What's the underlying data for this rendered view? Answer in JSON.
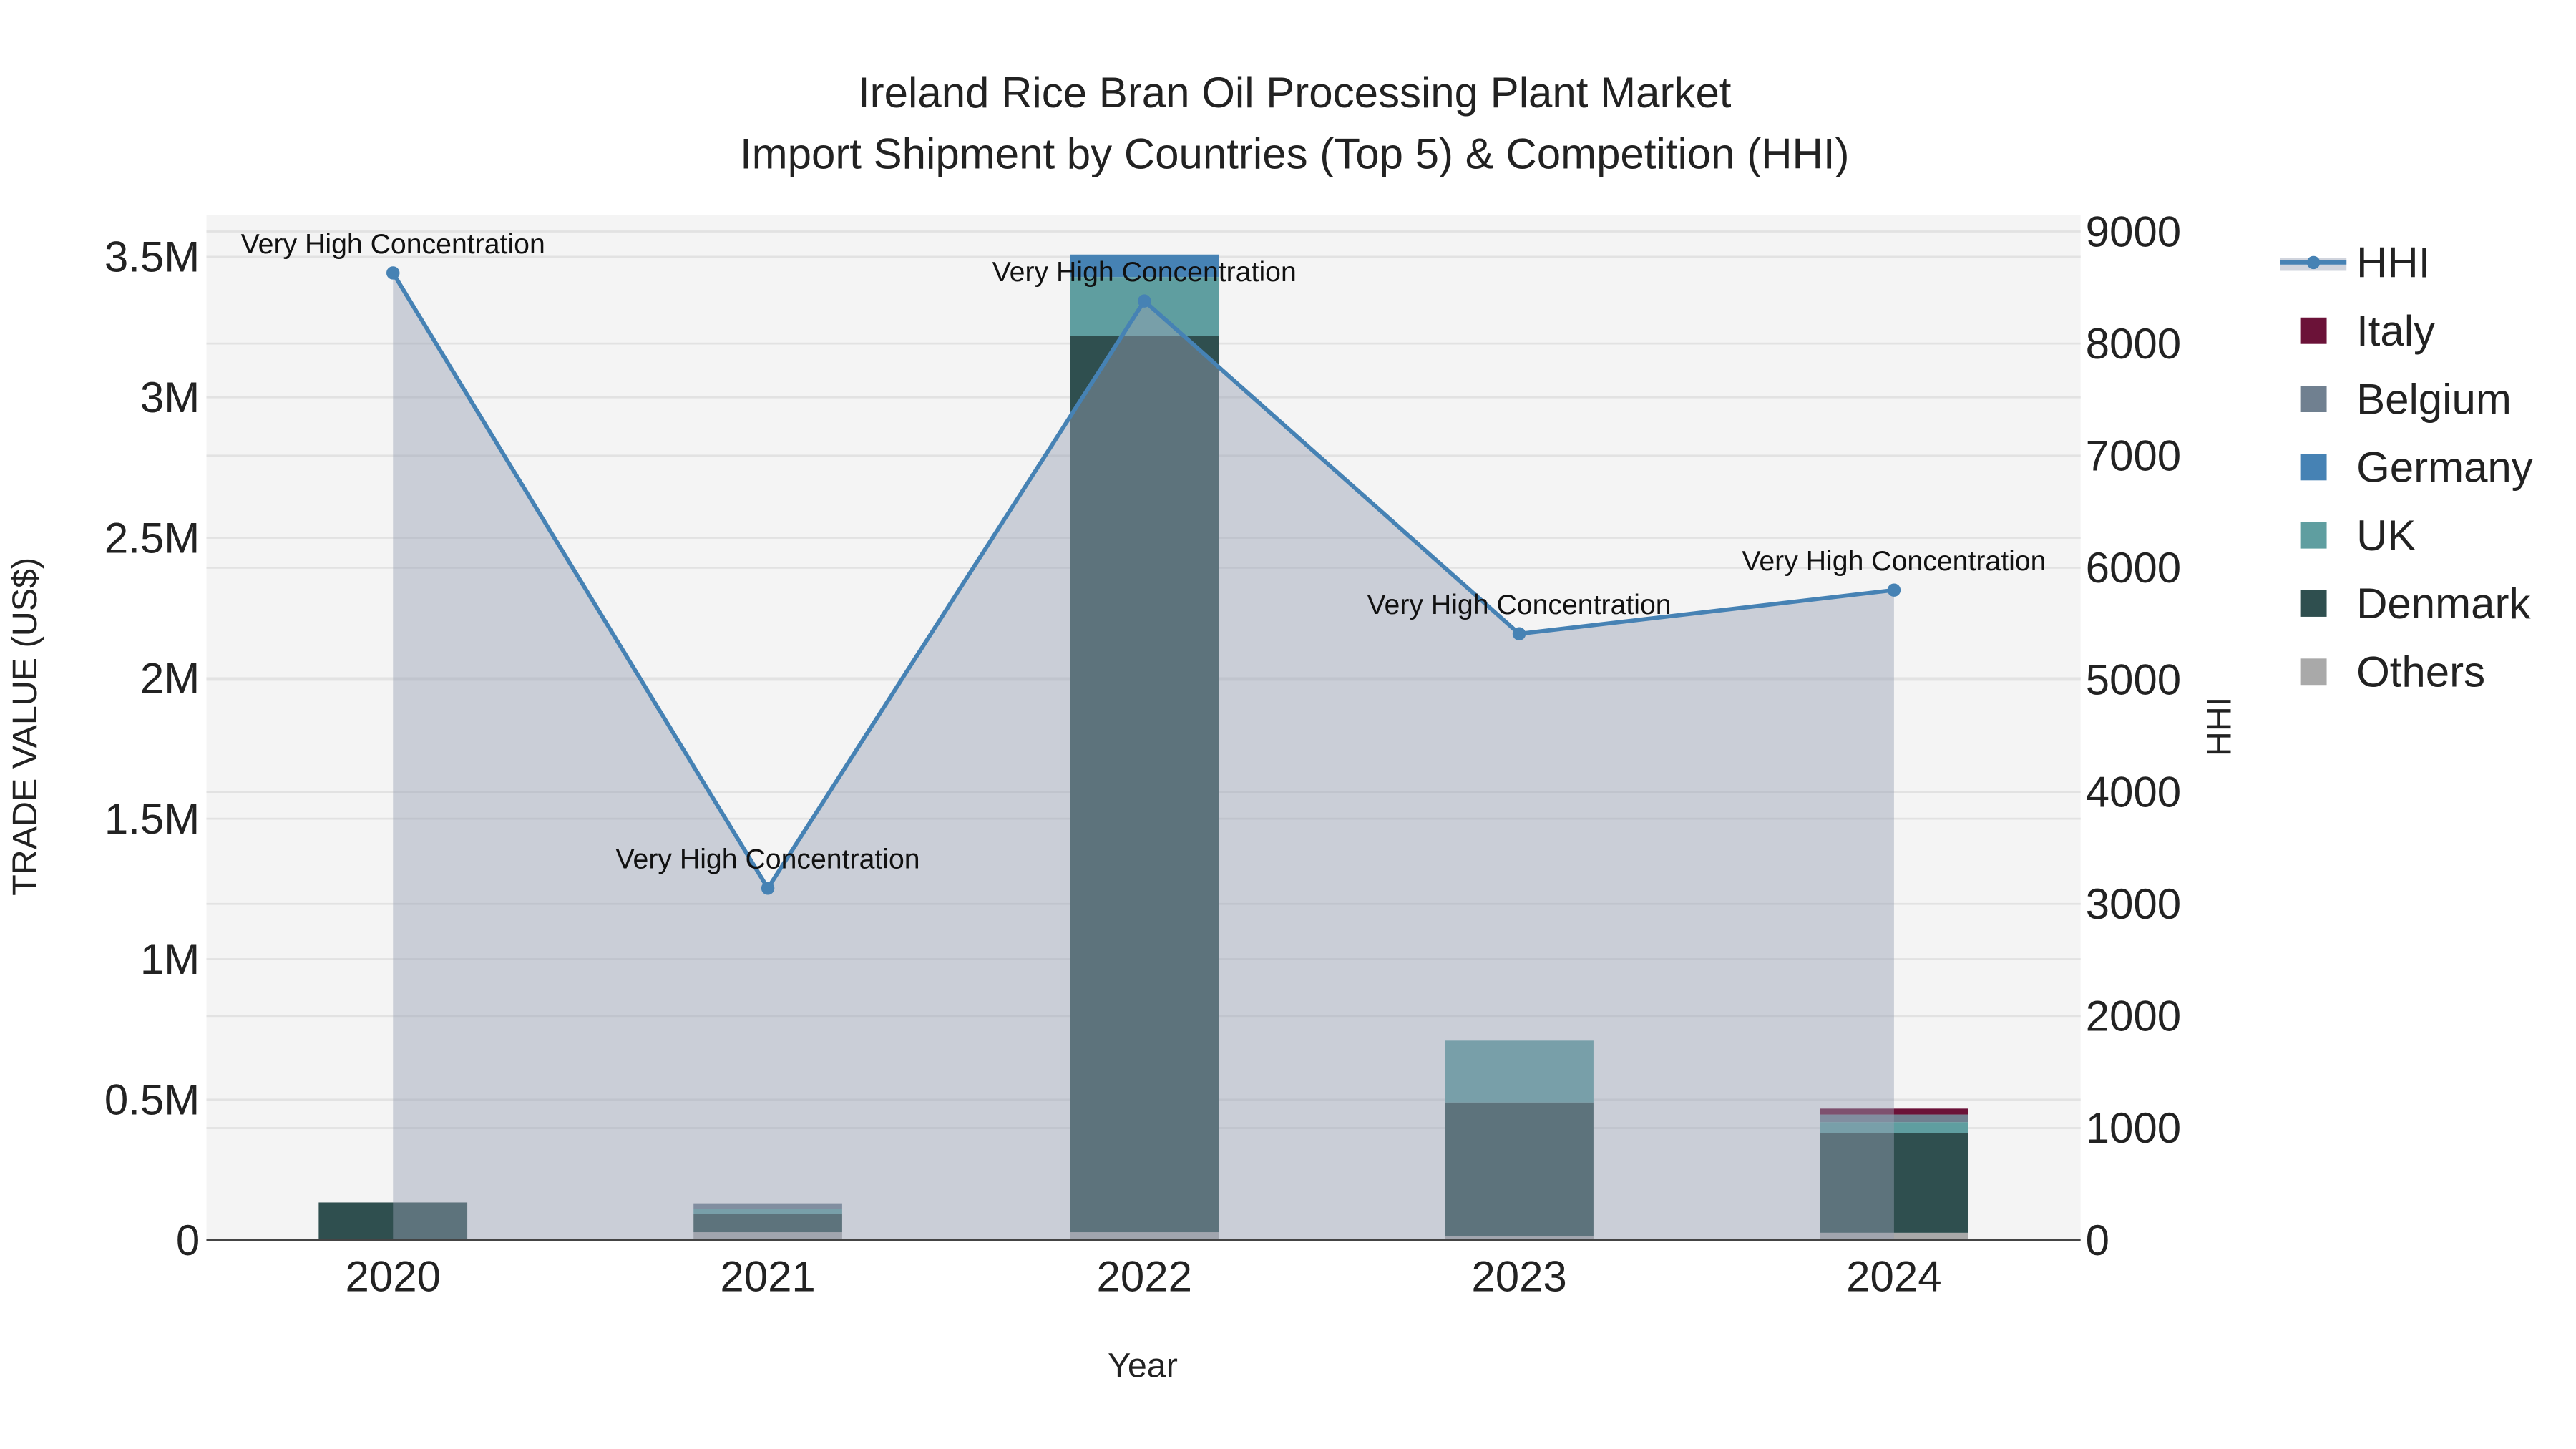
{
  "chart_data": {
    "type": "bar",
    "title_line1": "Ireland Rice Bran Oil Processing Plant Market",
    "title_line2": "Import Shipment by Countries (Top 5) & Competition (HHI)",
    "xlabel": "Year",
    "ylabel": "TRADE VALUE (US$)",
    "y2label": "HHI",
    "categories": [
      "2020",
      "2021",
      "2022",
      "2023",
      "2024"
    ],
    "ylim": [
      0,
      3650000
    ],
    "y2lim": [
      0,
      9150
    ],
    "yticks": [
      {
        "v": 0,
        "label": "0"
      },
      {
        "v": 500000,
        "label": "0.5M"
      },
      {
        "v": 1000000,
        "label": "1M"
      },
      {
        "v": 1500000,
        "label": "1.5M"
      },
      {
        "v": 2000000,
        "label": "2M"
      },
      {
        "v": 2500000,
        "label": "2.5M"
      },
      {
        "v": 3000000,
        "label": "3M"
      },
      {
        "v": 3500000,
        "label": "3.5M"
      }
    ],
    "y2ticks": [
      {
        "v": 0,
        "label": "0"
      },
      {
        "v": 1000,
        "label": "1000"
      },
      {
        "v": 2000,
        "label": "2000"
      },
      {
        "v": 3000,
        "label": "3000"
      },
      {
        "v": 4000,
        "label": "4000"
      },
      {
        "v": 5000,
        "label": "5000"
      },
      {
        "v": 6000,
        "label": "6000"
      },
      {
        "v": 7000,
        "label": "7000"
      },
      {
        "v": 8000,
        "label": "8000"
      },
      {
        "v": 9000,
        "label": "9000"
      }
    ],
    "series": [
      {
        "name": "Others",
        "color": "#a9a9a9",
        "values": [
          0,
          28000,
          28000,
          13000,
          26000
        ]
      },
      {
        "name": "Denmark",
        "color": "#2f4f4f",
        "values": [
          134000,
          65000,
          3190000,
          477000,
          354000
        ]
      },
      {
        "name": "UK",
        "color": "#5f9ea0",
        "values": [
          0,
          18000,
          210000,
          220000,
          40000
        ]
      },
      {
        "name": "Germany",
        "color": "#4682b4",
        "values": [
          0,
          0,
          80000,
          0,
          0
        ]
      },
      {
        "name": "Belgium",
        "color": "#708090",
        "values": [
          0,
          20000,
          0,
          0,
          27000
        ]
      },
      {
        "name": "Italy",
        "color": "#6b1238",
        "values": [
          0,
          0,
          0,
          0,
          21000
        ]
      }
    ],
    "hhi": {
      "name": "HHI",
      "color": "#4682b4",
      "values": [
        8630,
        3140,
        8380,
        5410,
        5800
      ],
      "annotations": [
        "Very High Concentration",
        "Very High Concentration",
        "Very High Concentration",
        "Very High Concentration",
        "Very High Concentration"
      ]
    },
    "legend": [
      "HHI",
      "Italy",
      "Belgium",
      "Germany",
      "UK",
      "Denmark",
      "Others"
    ],
    "legend_placement": "right",
    "grid": true
  }
}
